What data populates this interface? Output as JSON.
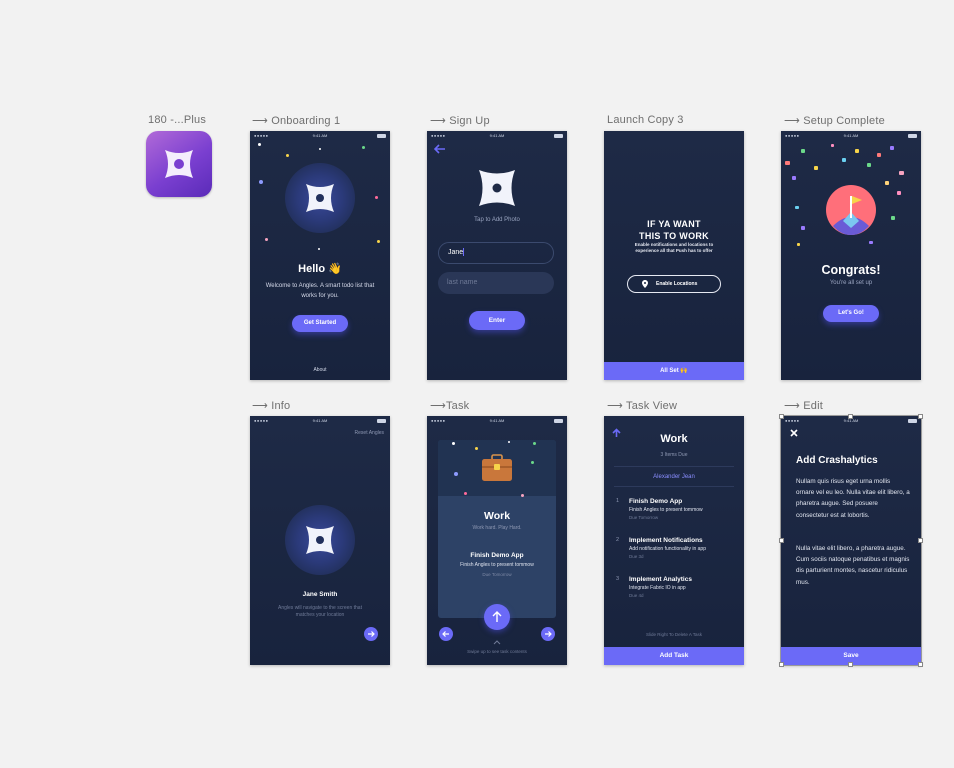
{
  "app_icon": {
    "label": "180 -...Plus"
  },
  "artboards": {
    "onboarding": {
      "label": "⟶ Onboarding 1",
      "time": "9:41 AM",
      "title": "Hello 👋",
      "body": "Welcome to Angles. A smart todo list that works for you.",
      "cta": "Get Started",
      "footer": "About"
    },
    "signup": {
      "label": "⟶ Sign Up",
      "time": "9:41 AM",
      "photo_hint": "Tap to Add Photo",
      "first_name_value": "Jane",
      "last_name_placeholder": "last name",
      "cta": "Enter"
    },
    "launch": {
      "label": "Launch Copy 3",
      "headline1": "IF YA WANT",
      "headline2": "THIS TO WORK",
      "body": "Enable notifications and locations to experience all that Push has to offer",
      "enable_button": "Enable Locations",
      "bottom_button": "All Set 🙌"
    },
    "setup": {
      "label": "⟶ Setup Complete",
      "time": "9:41 AM",
      "title": "Congrats!",
      "subtitle": "You're all set up",
      "cta": "Let's Go!"
    },
    "info": {
      "label": "⟶ Info",
      "time": "9:41 AM",
      "reset": "Reset Angles",
      "name": "Jane Smith",
      "body": "Angles will navigate to the screen that matches your location"
    },
    "task": {
      "label": "⟶Task",
      "time": "9:41 AM",
      "card_title": "Work",
      "card_subtitle": "Work hard. Play Hard.",
      "item_title": "Finish Demo App",
      "item_desc": "Finish Angles to present tommow",
      "item_due": "Due Tomorrow",
      "hint": "Swipe up to see task contents"
    },
    "taskview": {
      "label": "⟶ Task View",
      "title": "Work",
      "count": "3 Items Due",
      "user": "Alexander Jean",
      "items": [
        {
          "num": "1",
          "title": "Finish Demo App",
          "desc": "Finish Angles to present tommow",
          "due": "Due Tomorrow"
        },
        {
          "num": "2",
          "title": "Implement Notifications",
          "desc": "Add notification functionality in app",
          "due": "Due 3d"
        },
        {
          "num": "3",
          "title": "Implement Analytics",
          "desc": "Integrate Fabric IO in app",
          "due": "Due 4d"
        }
      ],
      "hint": "Slide Right To Delete A Task",
      "add_button": "Add Task"
    },
    "edit": {
      "label": "⟶ Edit",
      "time": "9:41 AM",
      "title": "Add Crashalytics",
      "para1": "Nullam quis risus eget urna mollis ornare vel eu leo. Nulla vitae elit libero, a pharetra augue. Sed posuere consectetur est at lobortis.",
      "para2": "Nulla vitae elit libero, a pharetra augue. Cum sociis natoque penatibus et magnis dis parturient montes, nascetur ridiculus mus.",
      "save_button": "Save"
    }
  },
  "colors": {
    "accent": "#6b6af7",
    "screen_bg": "#1e2a46",
    "canvas_bg": "#f2f2f2"
  }
}
